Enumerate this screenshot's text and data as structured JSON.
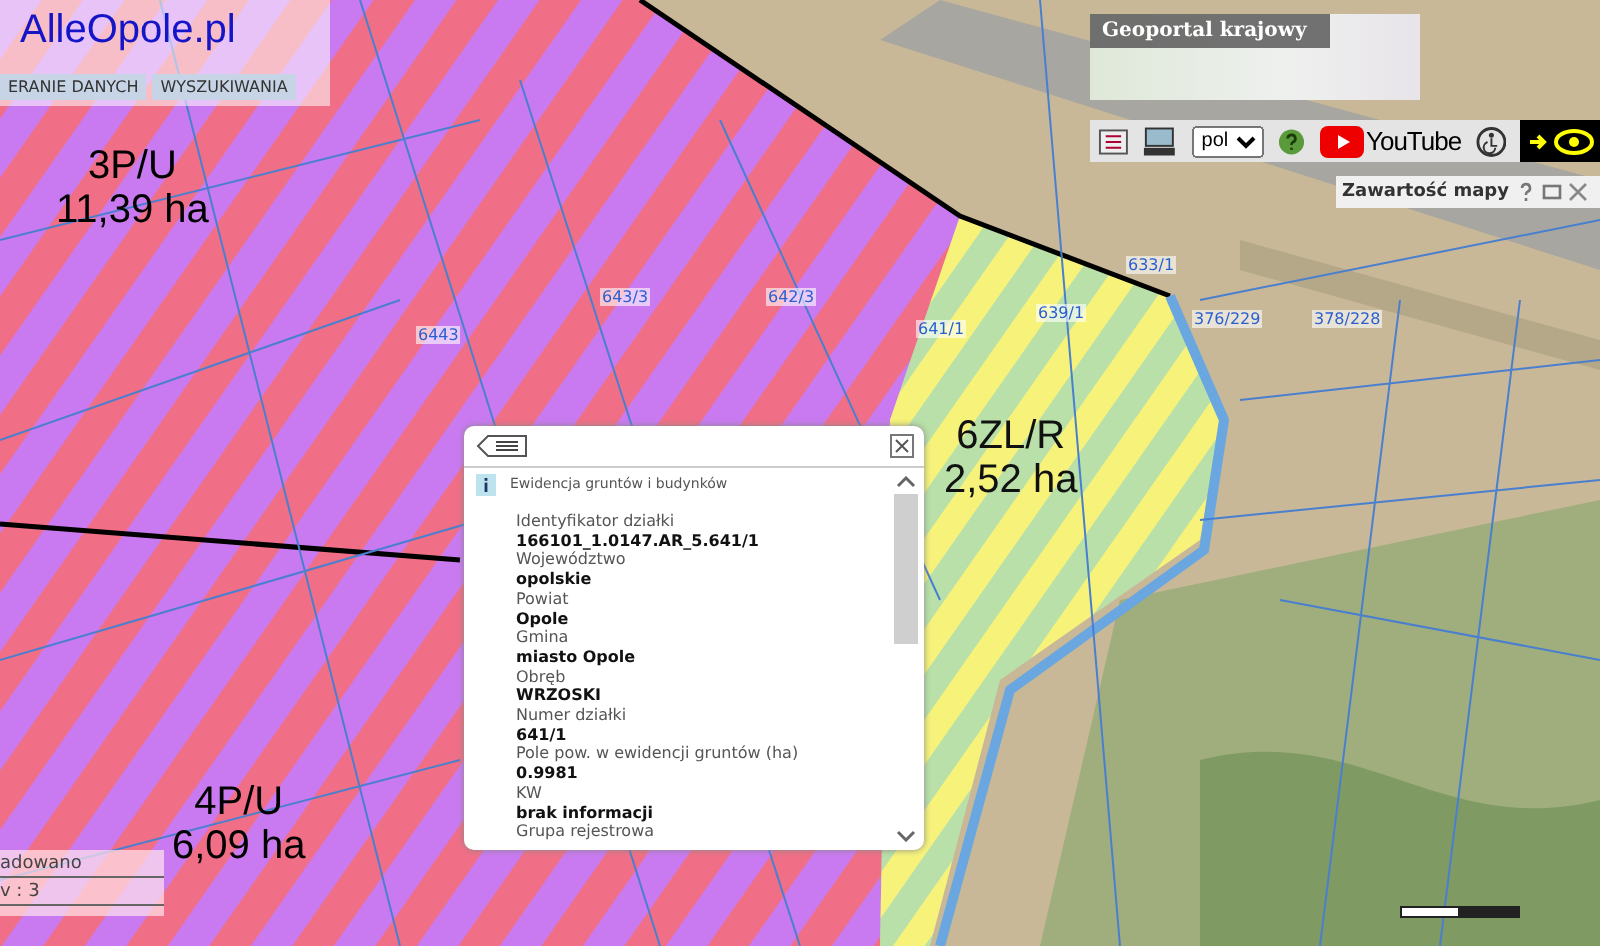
{
  "logo": {
    "title": "AlleOpole.pl"
  },
  "top_tabs": [
    {
      "label": "ERANIE DANYCH"
    },
    {
      "label": "WYSZUKIWANIA"
    }
  ],
  "minimap": {
    "title": "Geoportal krajowy"
  },
  "toolbar": {
    "language": "pol",
    "youtube_label": "YouTube",
    "contrast_on": true
  },
  "map_contents_panel": {
    "title": "Zawartość mapy"
  },
  "zones": [
    {
      "kind": "industrial",
      "code": "3P/U",
      "area": "11,39 ha"
    },
    {
      "kind": "green",
      "code": "6ZL/R",
      "area": "2,52 ha"
    },
    {
      "kind": "industrial",
      "code": "4P/U",
      "area": "6,09 ha"
    }
  ],
  "parcels": [
    "643/3",
    "642/3",
    "6443",
    "641/1",
    "639/1",
    "633/1",
    "376/229",
    "378/228"
  ],
  "popup": {
    "header": "Ewidencja gruntów i budynków",
    "fields": [
      {
        "label": "Identyfikator działki",
        "value": "166101_1.0147.AR_5.641/1"
      },
      {
        "label": "Województwo",
        "value": "opolskie"
      },
      {
        "label": "Powiat",
        "value": "Opole"
      },
      {
        "label": "Gmina",
        "value": "miasto Opole"
      },
      {
        "label": "Obręb",
        "value": "WRZOSKI"
      },
      {
        "label": "Numer działki",
        "value": "641/1"
      },
      {
        "label": "Pole pow. w ewidencji gruntów (ha)",
        "value": "0.9981"
      },
      {
        "label": "KW",
        "value": "brak informacji"
      }
    ],
    "last_label": "Grupa rejestrowa"
  },
  "status_box": {
    "line_1": "adowano",
    "line_2": "v : 3"
  }
}
